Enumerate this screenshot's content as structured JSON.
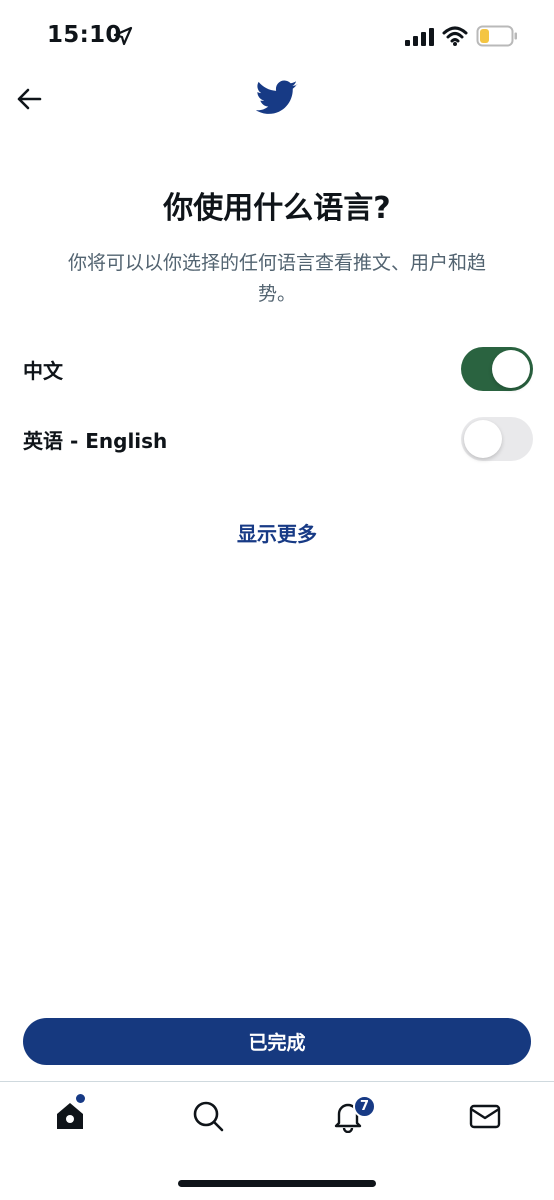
{
  "status_bar": {
    "time": "15:10",
    "icons": [
      "location-arrow-icon",
      "signal-icon",
      "wifi-icon",
      "battery-icon"
    ],
    "battery_level": 0.3,
    "battery_color": "#f4c542"
  },
  "header": {
    "back_icon": "arrow-left-icon",
    "logo_icon": "twitter-bird-icon",
    "brand_color": "#173a85"
  },
  "main": {
    "title": "你使用什么语言?",
    "subtitle": "你将可以以你选择的任何语言查看推文、用户和趋势。",
    "languages": [
      {
        "label": "中文",
        "enabled": true
      },
      {
        "label": "英语 - English",
        "enabled": false
      }
    ],
    "show_more_label": "显示更多",
    "done_label": "已完成",
    "toggle_on_color": "#2a6340"
  },
  "tab_bar": {
    "tabs": [
      {
        "name": "home",
        "icon": "home-icon",
        "has_dot": true
      },
      {
        "name": "search",
        "icon": "search-icon"
      },
      {
        "name": "notifications",
        "icon": "bell-icon",
        "badge": "7"
      },
      {
        "name": "messages",
        "icon": "envelope-icon"
      }
    ]
  }
}
